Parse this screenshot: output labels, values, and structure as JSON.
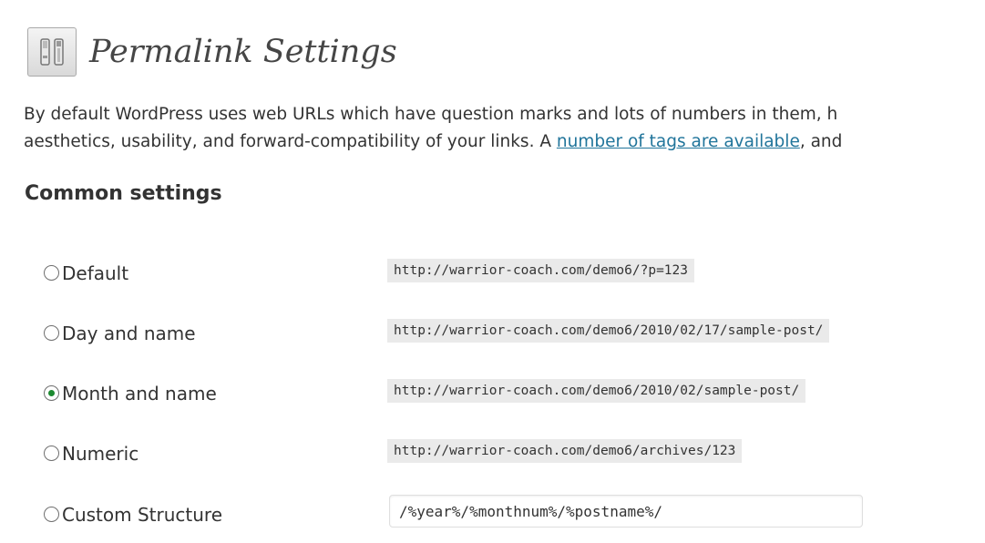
{
  "header": {
    "title": "Permalink Settings",
    "icon": "settings-tools-icon"
  },
  "intro": {
    "line1": "By default WordPress uses web URLs which have question marks and lots of numbers in them, h",
    "line2_before": "aesthetics, usability, and forward-compatibility of your links. A ",
    "link_text": "number of tags are available",
    "line2_after": ", and"
  },
  "common_settings": {
    "title": "Common settings",
    "options": [
      {
        "label": "Default",
        "example": "http://warrior-coach.com/demo6/?p=123",
        "checked": false
      },
      {
        "label": "Day and name",
        "example": "http://warrior-coach.com/demo6/2010/02/17/sample-post/",
        "checked": false
      },
      {
        "label": "Month and name",
        "example": "http://warrior-coach.com/demo6/2010/02/sample-post/",
        "checked": true
      },
      {
        "label": "Numeric",
        "example": "http://warrior-coach.com/demo6/archives/123",
        "checked": false
      },
      {
        "label": "Custom Structure",
        "value": "/%year%/%monthnum%/%postname%/",
        "checked": false
      }
    ]
  },
  "colors": {
    "link": "#21759b",
    "code_bg": "#eaeaea",
    "radio_dot": "#1d8a31"
  }
}
